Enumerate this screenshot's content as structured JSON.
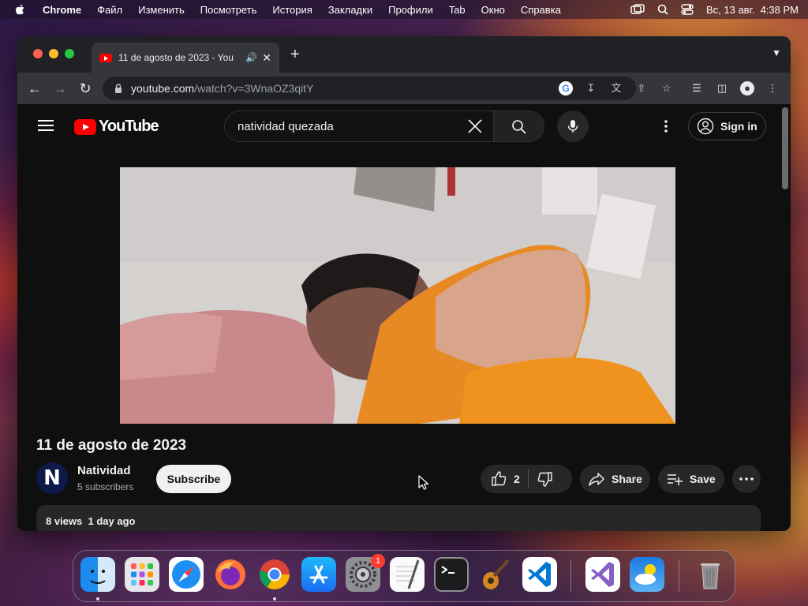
{
  "menubar": {
    "app": "Chrome",
    "items": [
      "Файл",
      "Изменить",
      "Посмотреть",
      "История",
      "Закладки",
      "Профили",
      "Tab",
      "Окно",
      "Справка"
    ],
    "clock": "Вс, 13 авг.  4:38 PM"
  },
  "browser": {
    "tab_title": "11 de agosto de 2023 - You",
    "url_host": "youtube.com",
    "url_path": "/watch?v=3WnaOZ3qitY"
  },
  "youtube": {
    "logo_text": "YouTube",
    "search_query": "natividad quezada",
    "sign_in": "Sign in",
    "video_title": "11 de agosto de 2023",
    "channel_initial": "N",
    "channel_name": "Natividad",
    "subscribers": "5 subscribers",
    "subscribe": "Subscribe",
    "likes": "2",
    "share": "Share",
    "save": "Save",
    "views": "8 views",
    "age": "1 day ago"
  },
  "dock": {
    "apps": [
      "Finder",
      "Launchpad",
      "Safari",
      "Firefox",
      "Chrome",
      "App Store",
      "System Settings",
      "TextEdit",
      "Terminal",
      "Instruments",
      "VS Code",
      "Visual Studio",
      "Weather",
      "Trash"
    ],
    "settings_badge": "1"
  },
  "colors": {
    "yt_bg": "#0f0f0f",
    "yt_red": "#ff0000",
    "chrome_toolbar": "#35363a"
  }
}
